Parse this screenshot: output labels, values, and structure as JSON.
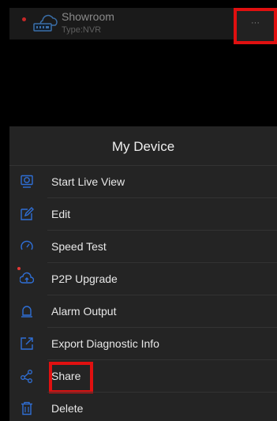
{
  "device": {
    "name": "Showroom",
    "type": "Type:NVR",
    "more_label": "···"
  },
  "sheet": {
    "title": "My Device",
    "items": [
      {
        "label": "Start Live View",
        "icon": "live-view-icon"
      },
      {
        "label": "Edit",
        "icon": "edit-icon"
      },
      {
        "label": "Speed Test",
        "icon": "speed-test-icon"
      },
      {
        "label": "P2P Upgrade",
        "icon": "upgrade-icon"
      },
      {
        "label": "Alarm Output",
        "icon": "alarm-output-icon"
      },
      {
        "label": "Export Diagnostic Info",
        "icon": "export-icon"
      },
      {
        "label": "Share",
        "icon": "share-icon"
      },
      {
        "label": "Delete",
        "icon": "delete-icon"
      }
    ]
  },
  "colors": {
    "accent_blue": "#2f6fd6",
    "highlight_red": "#e01010",
    "status_dot": "#c62828"
  }
}
